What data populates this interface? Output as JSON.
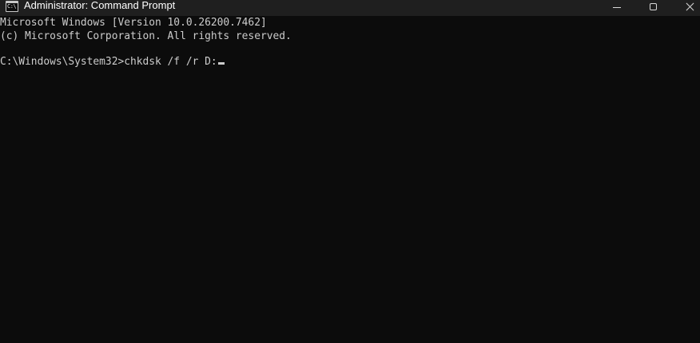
{
  "window": {
    "title": "Administrator: Command Prompt",
    "icon": "command-prompt-icon",
    "icon_glyph": "C:\\",
    "controls": {
      "minimize_icon": "minimize-icon",
      "maximize_icon": "maximize-icon",
      "close_icon": "close-icon"
    },
    "background_color": "#0c0c0c",
    "titlebar_color": "#1f1f1f",
    "text_color": "#cccccc"
  },
  "console": {
    "lines": [
      "Microsoft Windows [Version 10.0.26200.7462]",
      "(c) Microsoft Corporation. All rights reserved."
    ],
    "prompt": "C:\\Windows\\System32>",
    "command": "chkdsk /f /r D:"
  }
}
